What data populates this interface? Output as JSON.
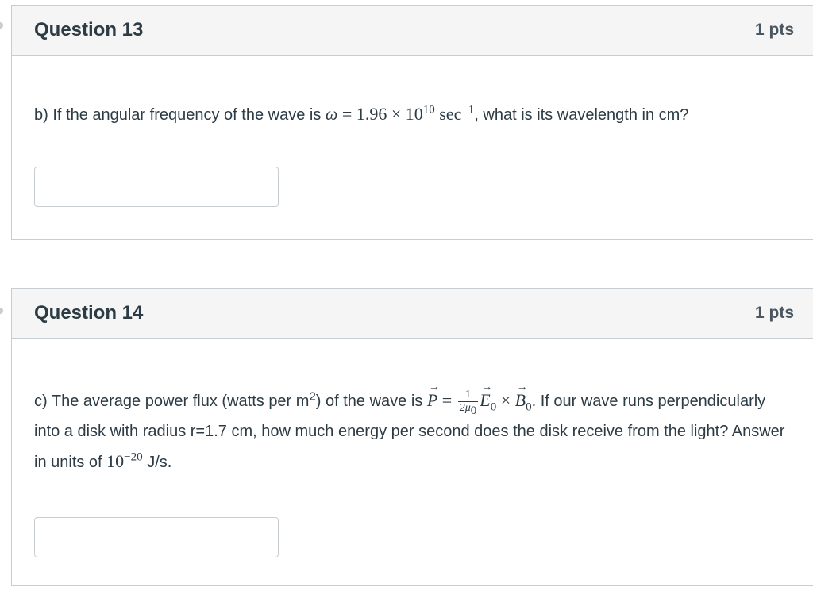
{
  "questions": [
    {
      "title": "Question 13",
      "points": "1 pts",
      "text_before": "b) If the angular frequency of the wave is ",
      "math_omega": "ω",
      "math_eq": " = 1.96 × 10",
      "math_exp": "10",
      "math_unit": " sec",
      "math_unit_exp": "−1",
      "text_after": ", what is its wavelength in cm?",
      "answer_value": ""
    },
    {
      "title": "Question 14",
      "points": "1 pts",
      "text_part1": "c) The average power flux (watts per m",
      "text_sup2": "2",
      "text_part2": ") of the wave is ",
      "vec_p": "P",
      "eq_sign": " = ",
      "frac_num": "1",
      "frac_den": "2μ",
      "frac_den_sub": "0",
      "vec_e": "E",
      "sub_e": "0",
      "times": " × ",
      "vec_b": "B",
      "sub_b": "0",
      "text_part3": ". If our wave runs perpendicularly into a disk with radius r=1.7 cm, how much energy per second does the disk receive from the light? Answer in units of ",
      "units_base": "10",
      "units_exp": "−20",
      "text_part4": " J/s.",
      "answer_value": ""
    }
  ]
}
